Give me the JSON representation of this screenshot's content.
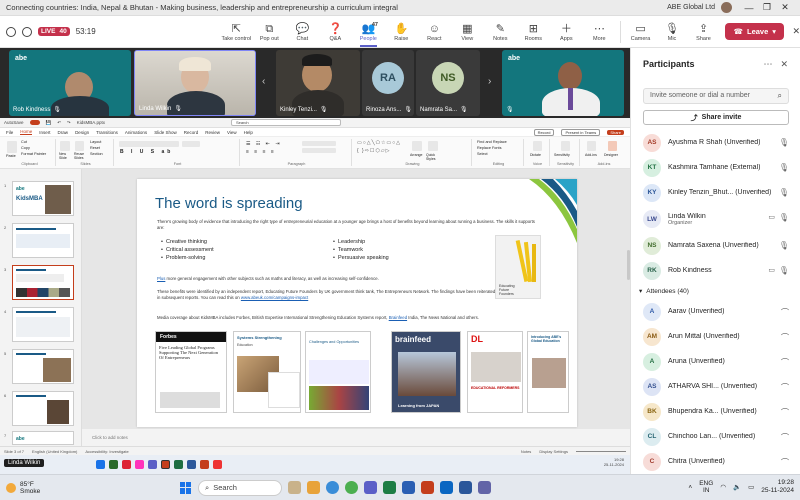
{
  "window": {
    "title": "Connecting countries: India, Nepal & Bhutan - Making business, leadership and entrepreneurship a curriculum integral",
    "org": "ABE Global Ltd",
    "controls": [
      "—",
      "❐",
      "✕"
    ]
  },
  "meeting_bar": {
    "live_label": "LIVE",
    "live_count": "40",
    "timer": "53:19",
    "people_count": "47",
    "tools": [
      {
        "label": "Take control",
        "icon": "⇱"
      },
      {
        "label": "Pop out",
        "icon": "⧉"
      },
      {
        "label": "Chat",
        "icon": "💬"
      },
      {
        "label": "Q&A",
        "icon": "❓"
      },
      {
        "label": "People",
        "icon": "👥"
      },
      {
        "label": "Raise",
        "icon": "✋"
      },
      {
        "label": "React",
        "icon": "☺"
      },
      {
        "label": "View",
        "icon": "▦"
      },
      {
        "label": "Notes",
        "icon": "✎"
      },
      {
        "label": "Rooms",
        "icon": "⊞"
      },
      {
        "label": "Apps",
        "icon": "＋"
      },
      {
        "label": "More",
        "icon": "⋯"
      }
    ],
    "camera_label": "Camera",
    "mic_label": "Mic",
    "share_label": "Share",
    "leave_label": "Leave"
  },
  "gallery": {
    "tiles": [
      {
        "name": "Rob Kindness",
        "type": "video"
      },
      {
        "name": "Linda Wilkin",
        "type": "video"
      },
      {
        "name": "Kinley Tenzi...",
        "type": "video"
      },
      {
        "name": "Rinoza Ans...",
        "initials": "RA",
        "type": "initials"
      },
      {
        "name": "Namrata Sa...",
        "initials": "NS",
        "type": "initials"
      },
      {
        "name": "",
        "type": "video"
      }
    ],
    "logo_text": "abe"
  },
  "ppt": {
    "autosave": "AutoSave",
    "filename": "KidsMBA.pptx",
    "search_placeholder": "Search",
    "menu": [
      "File",
      "Home",
      "Insert",
      "Draw",
      "Design",
      "Transitions",
      "Animations",
      "Slide Show",
      "Record",
      "Review",
      "View",
      "Help"
    ],
    "record_btn": "Record",
    "present_btn": "Present in Teams",
    "share_btn": "Share",
    "ribbon_groups": [
      "Clipboard",
      "Slides",
      "Font",
      "Paragraph",
      "Drawing",
      "Editing",
      "Voice",
      "Sensitivity",
      "Add-ins"
    ],
    "ribbon_buttons": {
      "paste": "Paste",
      "cut": "Cut",
      "copy": "Copy",
      "format_painter": "Format Painter",
      "new_slide": "New Slide",
      "reuse_slides": "Reuse Slides",
      "layout": "Layout",
      "reset": "Reset",
      "section": "Section",
      "arrange": "Arrange",
      "quick_styles": "Quick Styles",
      "find": "Find and Replace",
      "replace": "Replace Fonts",
      "select": "Select",
      "dictate": "Dictate",
      "sensitivity": "Sensitivity",
      "addins": "Add-ins",
      "designer": "Designer"
    },
    "slide": {
      "heading": "The word is spreading",
      "intro": "There's growing body of evidence that introducing the right type of entrepreneurial education at a younger age brings a host of benefits beyond learning about running a business. The skills it supports are:",
      "bullets_left": [
        "Creative thinking",
        "Critical assessment",
        "Problem-solving"
      ],
      "bullets_right": [
        "Leadership",
        "Teamwork",
        "Persuasive speaking"
      ],
      "plus_word": "Plus",
      "plus_text": " more general engagement with other subjects such as maths and literacy, as well as increasing self-confidence.",
      "benefits_text": "These benefits were identified by an independent report, Educating Future Founders by UK government think tank, The Entrepreneurs Network. The findings have been reiterated in subsequent reports. You can read this on ",
      "benefits_link": "www.abeuk.com/campaigns-impact",
      "media_text": "Media coverage about KidsMBA includes Forbes, British Expertise International Strengthening Education Systems report, ",
      "media_link": "Brainfeed",
      "media_text2": " India, The News National and others.",
      "book_caption": "Educating Future Founders",
      "covers": [
        {
          "title": "Forbes",
          "text": "Five Leading Global Programs Supporting The Next Generation Of Entrepreneurs"
        },
        {
          "title": "Systems Strengthening",
          "text": "Education"
        },
        {
          "title": "",
          "text": "Challenges and Opportunities"
        },
        {
          "title": "brainfeed",
          "text": "Learning from JAPAN"
        },
        {
          "title": "DL",
          "text": "EDUCATIONAL REFORMERS"
        },
        {
          "title": "",
          "text": "Introducing ABE's Global Education"
        }
      ]
    },
    "notes_placeholder": "Click to add notes",
    "status": {
      "slide_info": "Slide 3 of 7",
      "language": "English (United Kingdom)",
      "accessibility": "Accessibility: Investigate",
      "notes": "Notes",
      "display": "Display Settings"
    },
    "inner_time": "19:28",
    "inner_date": "25-11-2024",
    "presenter": "Linda Wilkin"
  },
  "participants": {
    "title": "Participants",
    "invite_placeholder": "Invite someone or dial a number",
    "share_invite": "Share invite",
    "organizers": [
      {
        "initials": "AS",
        "name": "Ayushma R Shah (Unverified)",
        "color": "#f8dcd7",
        "fg": "#a33b28"
      },
      {
        "initials": "KT",
        "name": "Kashmira Tamhane (External)",
        "color": "#d6efe0",
        "fg": "#227243"
      },
      {
        "initials": "KY",
        "name": "Kinley Tenzin_Bhut... (Unverified)",
        "color": "#dce7f7",
        "fg": "#2b5597"
      },
      {
        "initials": "LW",
        "name": "Linda Wilkin",
        "sub": "Organizer",
        "color": "#e7eaf5",
        "fg": "#3b4a8f"
      },
      {
        "initials": "NS",
        "name": "Namrata Saxena (Unverified)",
        "color": "#e0ecd8",
        "fg": "#3f6b2a"
      },
      {
        "initials": "RK",
        "name": "Rob Kindness",
        "color": "#d9ebe3",
        "fg": "#266048"
      }
    ],
    "attendees_label": "Attendees (40)",
    "attendees": [
      {
        "initials": "A",
        "name": "Aarav (Unverified)",
        "color": "#dfe8f7",
        "fg": "#2f5aa8"
      },
      {
        "initials": "AM",
        "name": "Arun Mittal (Unverified)",
        "color": "#f7e6cf",
        "fg": "#8a5a12"
      },
      {
        "initials": "A",
        "name": "Aruna (Unverified)",
        "color": "#d7efe0",
        "fg": "#236e42"
      },
      {
        "initials": "AS",
        "name": "ATHARVA SHI... (Unverified)",
        "color": "#dde4f5",
        "fg": "#34508f"
      },
      {
        "initials": "BK",
        "name": "Bhupendra Ka... (Unverified)",
        "color": "#f6e7c9",
        "fg": "#8a6512"
      },
      {
        "initials": "CL",
        "name": "Chinchoo Lan... (Unverified)",
        "color": "#dcecf0",
        "fg": "#256472"
      },
      {
        "initials": "C",
        "name": "Chitra (Unverified)",
        "color": "#f7dcd8",
        "fg": "#a03b2e"
      }
    ]
  },
  "taskbar": {
    "temp": "85°F",
    "weather": "Smoke",
    "search_placeholder": "Search",
    "lang1": "ENG",
    "lang2": "IN",
    "time": "19:28",
    "date": "25-11-2024"
  },
  "colors": {
    "brand_teams": "#5b5fc7",
    "leave_red": "#c4314b",
    "ppt_orange": "#c43e1c",
    "abe_teal": "#13767d",
    "slide_heading": "#1a5a86"
  }
}
